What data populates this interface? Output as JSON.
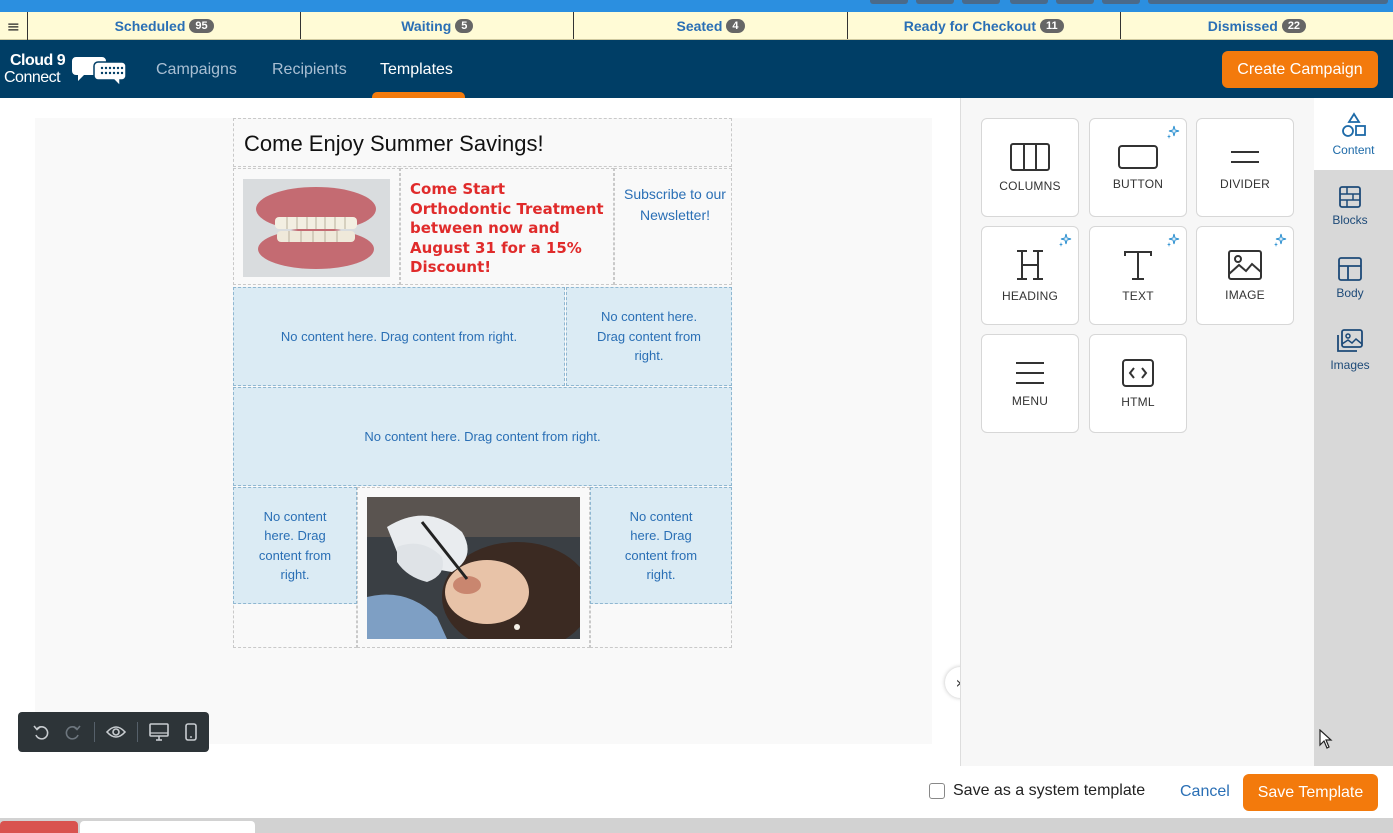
{
  "status_bar": {
    "tabs": [
      {
        "label": "Scheduled",
        "count": "95"
      },
      {
        "label": "Waiting",
        "count": "5"
      },
      {
        "label": "Seated",
        "count": "4"
      },
      {
        "label": "Ready for Checkout",
        "count": "11"
      },
      {
        "label": "Dismissed",
        "count": "22"
      }
    ]
  },
  "logo": {
    "line1": "Cloud 9",
    "line2": "Connect"
  },
  "nav": {
    "items": [
      {
        "label": "Campaigns"
      },
      {
        "label": "Recipients"
      },
      {
        "label": "Templates",
        "active": true
      }
    ],
    "create_button": "Create Campaign"
  },
  "template": {
    "title": "Come Enjoy Summer Savings!",
    "promo_text": "Come Start Orthodontic Treatment between now and August 31 for a 15% Discount!",
    "subscribe_text": "Subscribe to our Newsletter!",
    "dropzone_text": "No content here. Drag content from right."
  },
  "content_panel": {
    "tiles": [
      {
        "label": "COLUMNS",
        "icon": "columns-icon",
        "ai": false
      },
      {
        "label": "BUTTON",
        "icon": "button-icon",
        "ai": true
      },
      {
        "label": "DIVIDER",
        "icon": "divider-icon",
        "ai": false
      },
      {
        "label": "HEADING",
        "icon": "heading-icon",
        "ai": true
      },
      {
        "label": "TEXT",
        "icon": "text-icon",
        "ai": true
      },
      {
        "label": "IMAGE",
        "icon": "image-icon",
        "ai": true
      },
      {
        "label": "MENU",
        "icon": "menu-icon",
        "ai": false
      },
      {
        "label": "HTML",
        "icon": "html-icon",
        "ai": false
      }
    ]
  },
  "side_tabs": [
    {
      "label": "Content",
      "icon": "shapes-icon",
      "active": true
    },
    {
      "label": "Blocks",
      "icon": "blocks-icon"
    },
    {
      "label": "Body",
      "icon": "layout-icon"
    },
    {
      "label": "Images",
      "icon": "images-icon"
    }
  ],
  "footer": {
    "system_template_label": "Save as a system template",
    "system_template_checked": false,
    "cancel_label": "Cancel",
    "save_label": "Save Template"
  },
  "colors": {
    "navbar": "#003e66",
    "accent": "#f37a0c",
    "status_bar": "#fffbd6",
    "link": "#2a6fb5",
    "promo": "#e02b2b",
    "dropzone": "#dbebf4"
  }
}
